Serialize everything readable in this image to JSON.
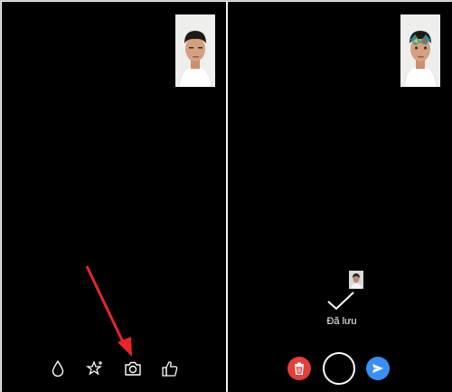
{
  "left_panel": {
    "self_view": {
      "description_icon": "person-photo"
    },
    "toolbar": [
      {
        "name": "filter-icon"
      },
      {
        "name": "effects-icon"
      },
      {
        "name": "camera-icon"
      },
      {
        "name": "like-icon"
      }
    ]
  },
  "right_panel": {
    "self_view": {
      "description_icon": "person-photo-with-face-paint"
    },
    "saved": {
      "label": "Đã lưu"
    },
    "actions": [
      {
        "name": "delete-icon",
        "color": "#e0413c"
      },
      {
        "name": "shutter-button",
        "color": "#ffffff"
      },
      {
        "name": "send-icon",
        "color": "#3b8ff2"
      }
    ]
  },
  "colors": {
    "background": "#000000",
    "annotation_arrow": "#e8262a"
  }
}
